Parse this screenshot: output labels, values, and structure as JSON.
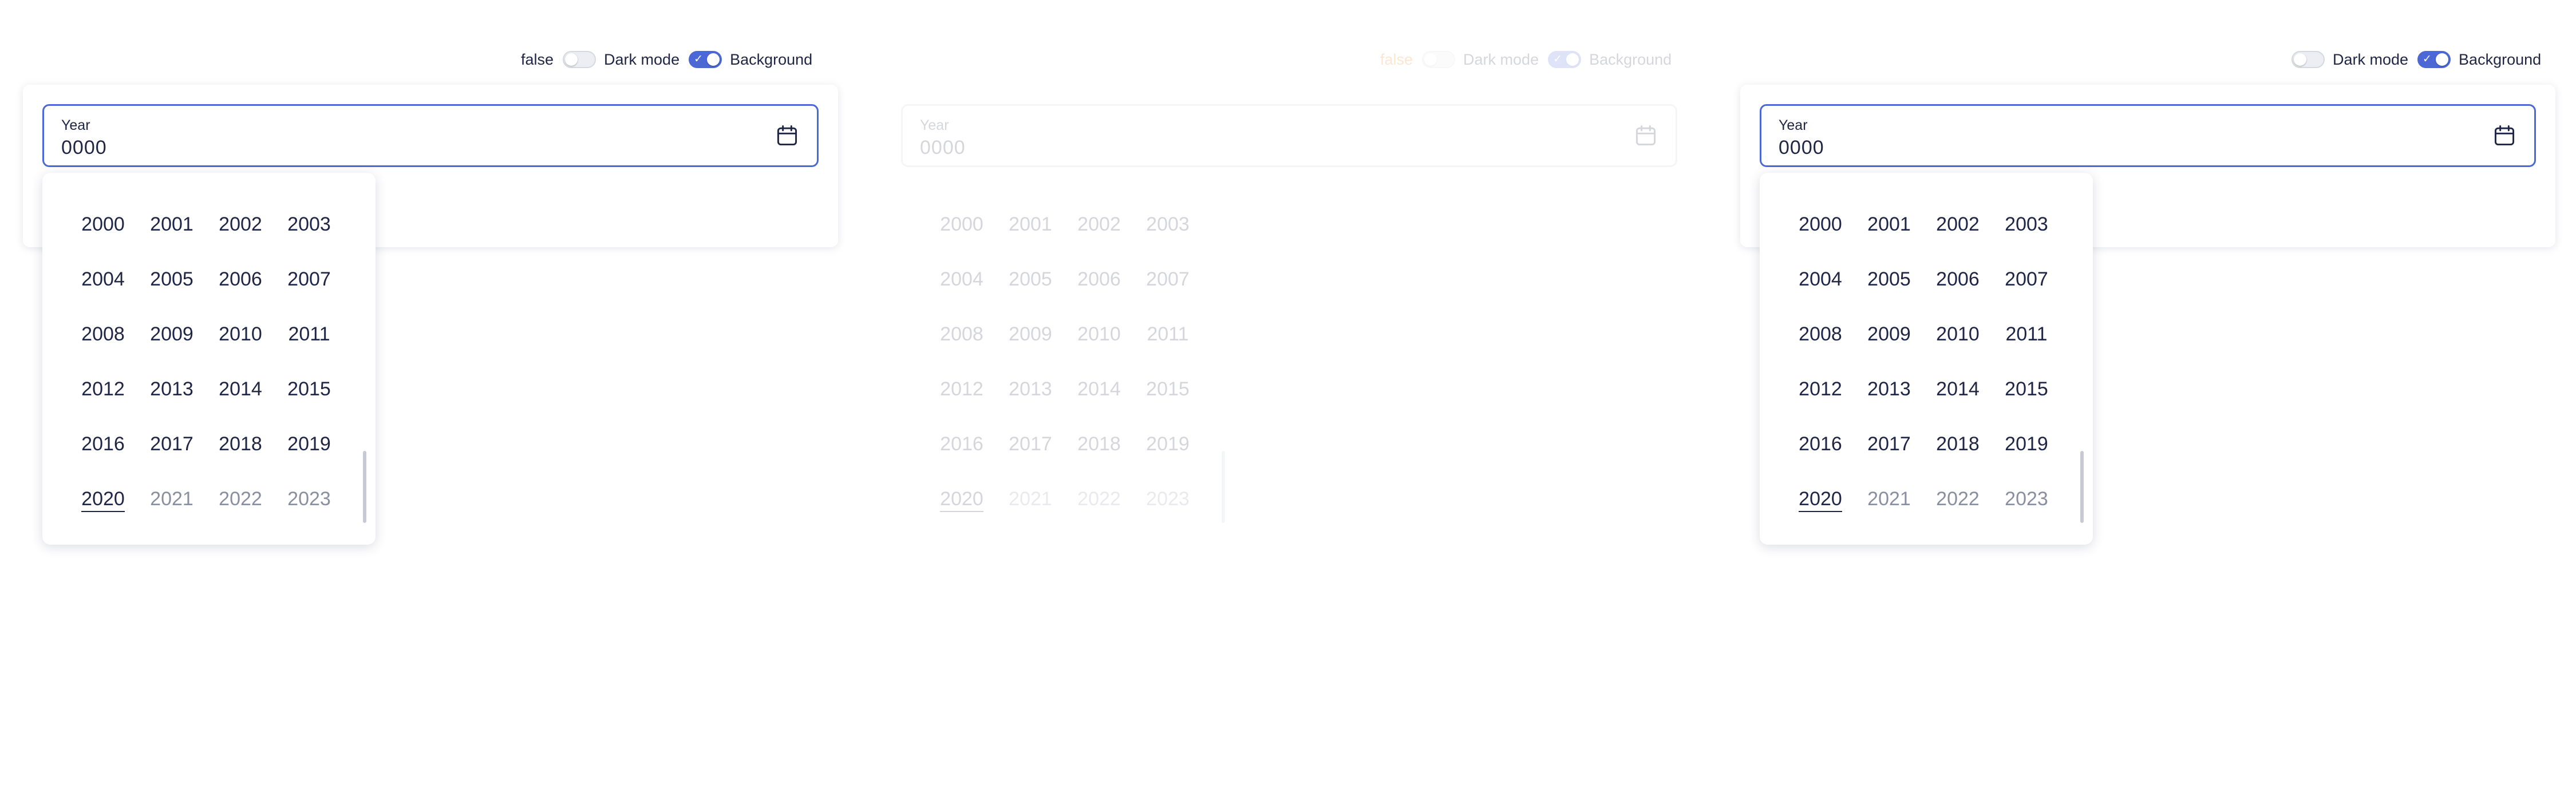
{
  "panels": [
    {
      "id": "p1",
      "controls": {
        "state_text": "false",
        "dark_mode_label": "Dark mode",
        "dark_mode_on": false,
        "background_label": "Background",
        "background_on": true
      },
      "field": {
        "label": "Year",
        "value": "0000",
        "icon": "calendar-icon"
      },
      "years": [
        "2000",
        "2001",
        "2002",
        "2003",
        "2004",
        "2005",
        "2006",
        "2007",
        "2008",
        "2009",
        "2010",
        "2011",
        "2012",
        "2013",
        "2014",
        "2015",
        "2016",
        "2017",
        "2018",
        "2019",
        "2020",
        "2021",
        "2022",
        "2023"
      ],
      "current_year": "2020"
    },
    {
      "id": "p2",
      "controls": {
        "state_text": "false",
        "dark_mode_label": "Dark mode",
        "dark_mode_on": false,
        "background_label": "Background",
        "background_on": true
      },
      "field": {
        "label": "Year",
        "value": "0000",
        "icon": "calendar-icon"
      },
      "years": [
        "2000",
        "2001",
        "2002",
        "2003",
        "2004",
        "2005",
        "2006",
        "2007",
        "2008",
        "2009",
        "2010",
        "2011",
        "2012",
        "2013",
        "2014",
        "2015",
        "2016",
        "2017",
        "2018",
        "2019",
        "2020",
        "2021",
        "2022",
        "2023"
      ],
      "current_year": "2020"
    },
    {
      "id": "p3",
      "controls": {
        "dark_mode_label": "Dark mode",
        "dark_mode_on": false,
        "background_label": "Background",
        "background_on": true
      },
      "field": {
        "label": "Year",
        "value": "0000",
        "icon": "calendar-icon"
      },
      "years": [
        "2000",
        "2001",
        "2002",
        "2003",
        "2004",
        "2005",
        "2006",
        "2007",
        "2008",
        "2009",
        "2010",
        "2011",
        "2012",
        "2013",
        "2014",
        "2015",
        "2016",
        "2017",
        "2018",
        "2019",
        "2020",
        "2021",
        "2022",
        "2023"
      ],
      "current_year": "2020"
    }
  ],
  "colors": {
    "accent": "#4c68d6",
    "text": "#1f2544",
    "muted": "#8a8fa0",
    "warning": "#f07800"
  }
}
